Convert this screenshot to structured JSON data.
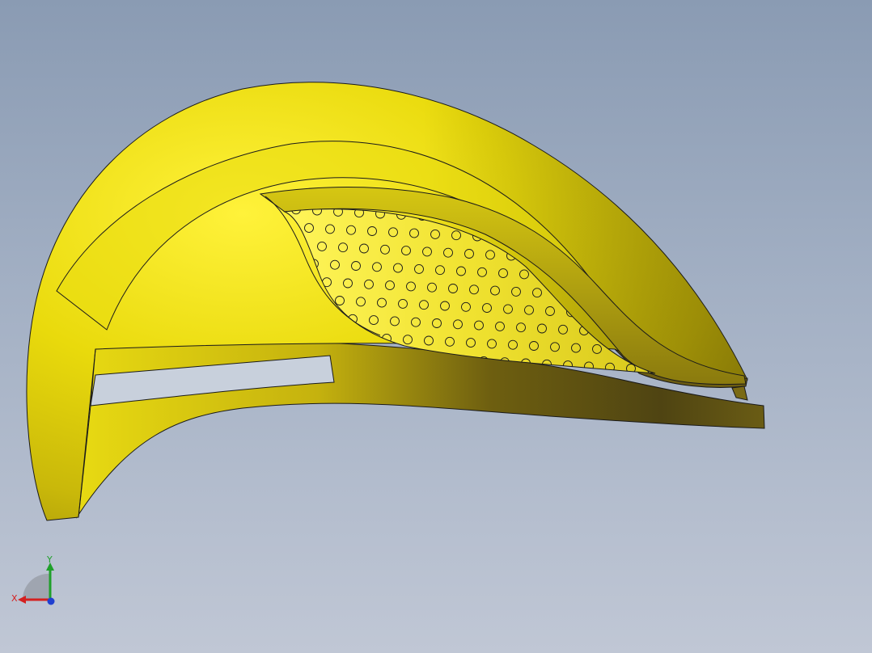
{
  "viewport": {
    "background_top": "#8a9bb3",
    "background_bottom": "#c0c7d5"
  },
  "model": {
    "shell_color": "#f2e400",
    "shell_shadow_color": "#4f4412",
    "edge_color": "#1a1a1a",
    "opening_color": "#c8d0dc"
  },
  "triad": {
    "x_label": "X",
    "y_label": "Y",
    "x_color": "#d42020",
    "y_color": "#1fa02a",
    "z_color": "#2040d0"
  }
}
